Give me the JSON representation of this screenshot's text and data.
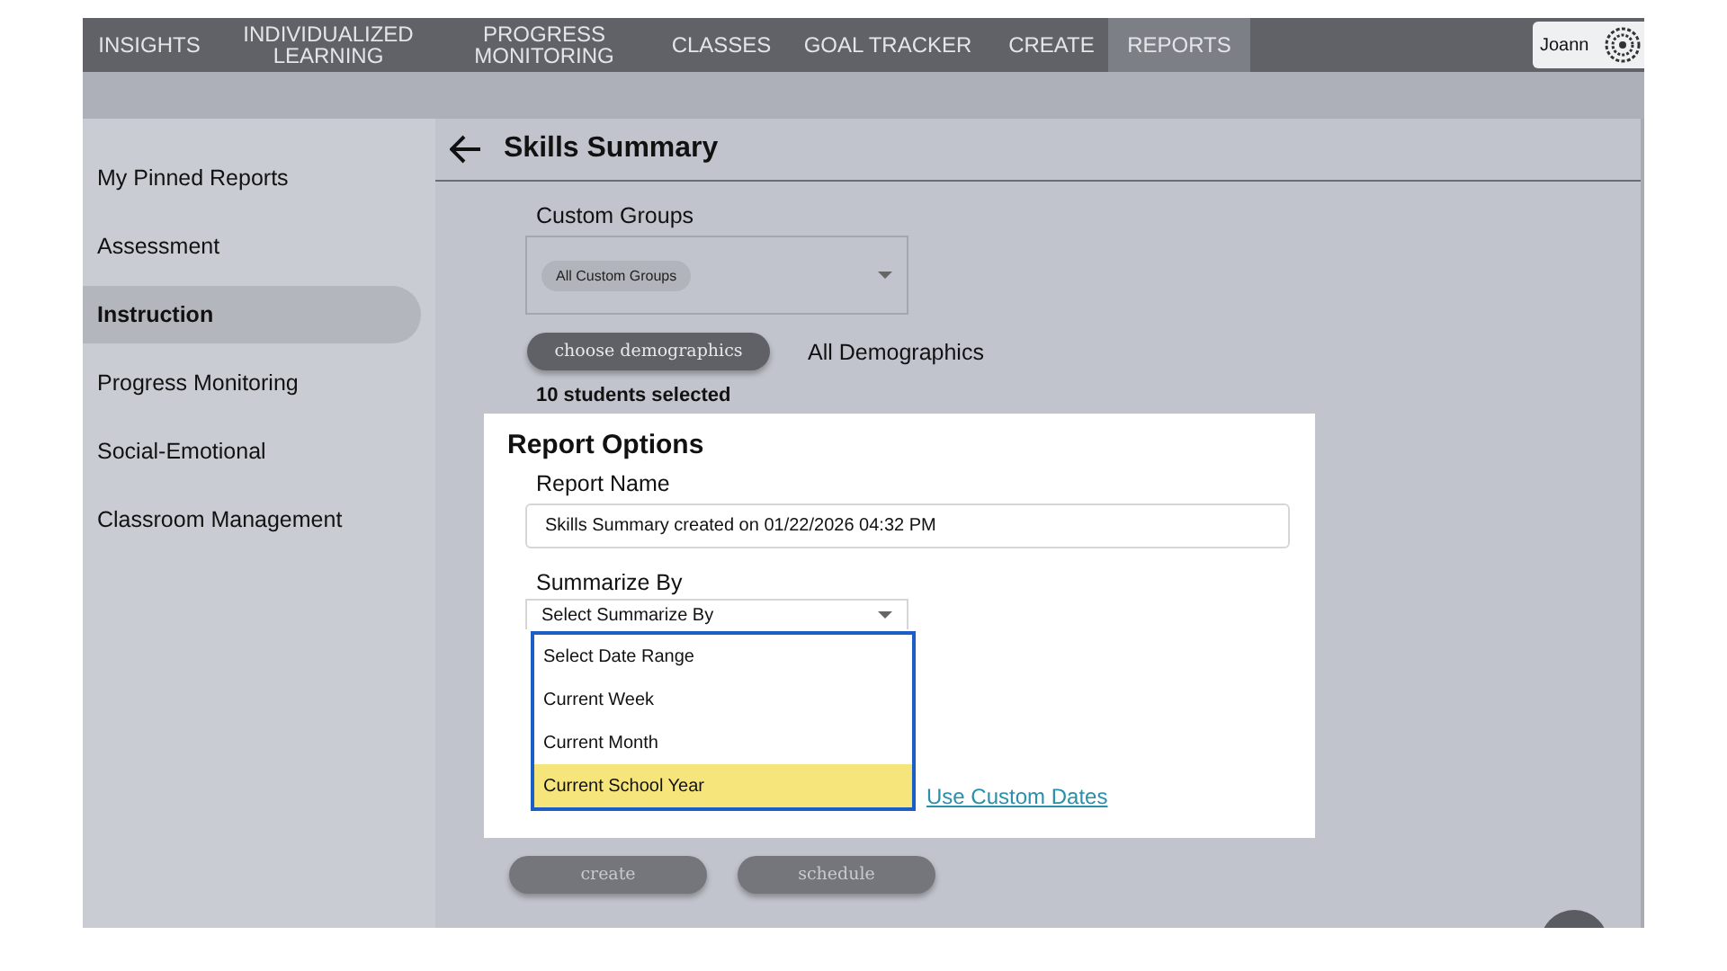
{
  "nav": {
    "items": [
      {
        "label": "INSIGHTS",
        "selected": false
      },
      {
        "label": "INDIVIDUALIZED LEARNING",
        "selected": false
      },
      {
        "label": "PROGRESS MONITORING",
        "selected": false
      },
      {
        "label": "CLASSES",
        "selected": false
      },
      {
        "label": "GOAL TRACKER",
        "selected": false
      },
      {
        "label": "CREATE",
        "selected": false
      },
      {
        "label": "REPORTS",
        "selected": true
      }
    ],
    "user": {
      "name": "Joann"
    }
  },
  "sidebar": {
    "items": [
      {
        "label": "My Pinned Reports",
        "selected": false
      },
      {
        "label": "Assessment",
        "selected": false
      },
      {
        "label": "Instruction",
        "selected": true
      },
      {
        "label": "Progress Monitoring",
        "selected": false
      },
      {
        "label": "Social-Emotional",
        "selected": false
      },
      {
        "label": "Classroom Management",
        "selected": false
      }
    ]
  },
  "page": {
    "title": "Skills Summary"
  },
  "filters": {
    "custom_groups": {
      "label": "Custom Groups",
      "chip": "All Custom Groups"
    },
    "demographics_button": "choose demographics",
    "demographics_value": "All Demographics",
    "selection_count": "10 students selected"
  },
  "report_options": {
    "title": "Report Options",
    "report_name": {
      "label": "Report Name",
      "value": "Skills Summary created on 01/22/2026 04:32 PM"
    },
    "summarize_by": {
      "label": "Summarize By",
      "value": "Select Summarize By"
    },
    "date_range_options": [
      {
        "label": "Select Date Range",
        "selected": false
      },
      {
        "label": "Current Week",
        "selected": false
      },
      {
        "label": "Current Month",
        "selected": false
      },
      {
        "label": "Current School Year",
        "selected": true
      }
    ],
    "custom_dates_link": "Use Custom Dates"
  },
  "buttons": [
    "create",
    "schedule"
  ]
}
